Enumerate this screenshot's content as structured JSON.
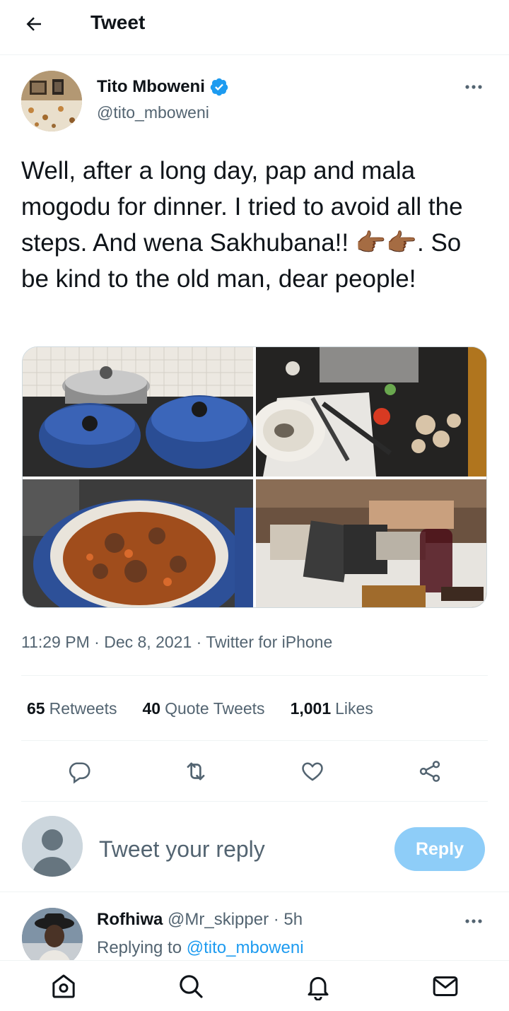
{
  "header": {
    "title": "Tweet",
    "back_icon": "arrow-left-icon"
  },
  "author": {
    "name": "Tito Mboweni",
    "handle": "@tito_mboweni",
    "verified": true,
    "verified_color": "#1d9bf0"
  },
  "tweet": {
    "text": "Well, after a long day, pap and mala mogodu for dinner. I tried to avoid all the steps. And wena Sakhubana!! 👉🏾👉🏾. So be kind to the old man, dear people!",
    "time": "11:29 PM",
    "date": "Dec 8, 2021",
    "source": "Twitter for iPhone",
    "separator": "·"
  },
  "media": {
    "photos": [
      "photo-cooking-pots",
      "photo-plate-and-cutting-board",
      "photo-pot-of-stew",
      "photo-dinner-table-with-books"
    ]
  },
  "stats": {
    "retweets_count": "65",
    "retweets_label": "Retweets",
    "quotes_count": "40",
    "quotes_label": "Quote Tweets",
    "likes_count": "1,001",
    "likes_label": "Likes"
  },
  "actions": [
    "reply-icon",
    "retweet-icon",
    "like-icon",
    "share-icon"
  ],
  "reply_box": {
    "placeholder": "Tweet your reply",
    "button_label": "Reply",
    "button_color": "#8ecdf8"
  },
  "first_reply": {
    "author": "Rofhiwa",
    "handle": "@Mr_skipper",
    "separator": "·",
    "time": "5h",
    "replying_prefix": "Replying to",
    "replying_to": "@tito_mboweni"
  },
  "tabbar": [
    "home-icon",
    "search-icon",
    "notifications-icon",
    "messages-icon"
  ],
  "colors": {
    "accent": "#1d9bf0",
    "secondary_text": "#536471",
    "divider": "#eff3f4"
  }
}
